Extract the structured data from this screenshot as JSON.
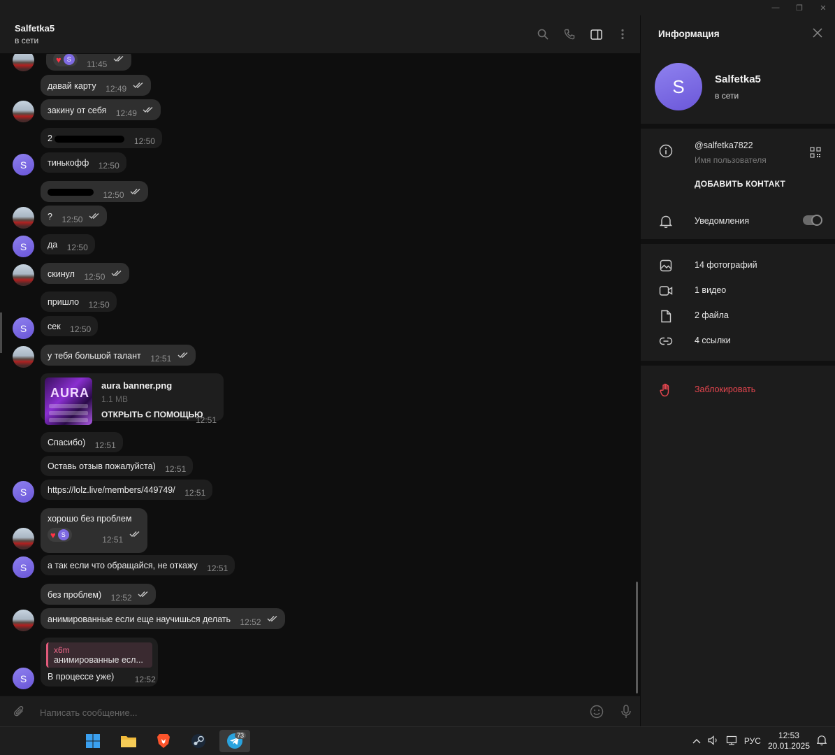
{
  "chat": {
    "peer_name": "Salfetka5",
    "peer_status": "в сети",
    "composer_placeholder": "Написать сообщение..."
  },
  "messages": [
    {
      "text": "",
      "time": "11:45",
      "reaction": "♥",
      "reaction_user": "S"
    },
    {
      "text": "давай карту",
      "time": "12:49"
    },
    {
      "text": "закину от себя",
      "time": "12:49"
    },
    {
      "text": "2",
      "time": "12:50",
      "redacted": true
    },
    {
      "text": "тинькофф",
      "time": "12:50"
    },
    {
      "text": "",
      "time": "12:50",
      "redacted": true
    },
    {
      "text": "?",
      "time": "12:50"
    },
    {
      "text": "да",
      "time": "12:50"
    },
    {
      "text": "скинул",
      "time": "12:50"
    },
    {
      "text": "пришло",
      "time": "12:50"
    },
    {
      "text": "сек",
      "time": "12:50"
    },
    {
      "text": "у тебя большой талант",
      "time": "12:51"
    },
    {
      "file_name": "aura banner.png",
      "file_size": "1.1 MB",
      "open_with": "ОТКРЫТЬ С ПОМОЩЬЮ",
      "thumb_text": "AURA",
      "time": "12:51"
    },
    {
      "text": "Спасибо)",
      "time": "12:51"
    },
    {
      "text": "Оставь отзыв пожалуйста)",
      "time": "12:51"
    },
    {
      "text": "https://lolz.live/members/449749/",
      "time": "12:51"
    },
    {
      "text": "хорошо без проблем",
      "time": "12:51",
      "reaction": "♥",
      "reaction_user": "S"
    },
    {
      "text": "а так если что обращайся, не откажу",
      "time": "12:51"
    },
    {
      "text": "без проблем)",
      "time": "12:52"
    },
    {
      "text": "анимированные если еще научишься делать",
      "time": "12:52"
    },
    {
      "reply_name": "x6m",
      "reply_text": "анимированные есл...",
      "text": "В процессе уже)",
      "time": "12:52"
    }
  ],
  "avatar_letter": "S",
  "info": {
    "title": "Информация",
    "name": "Salfetka5",
    "status": "в сети",
    "avatar_letter": "S",
    "username": "@salfetka7822",
    "username_label": "Имя пользователя",
    "add_contact": "ДОБАВИТЬ КОНТАКТ",
    "notifications": "Уведомления",
    "notifications_on": true,
    "photos": "14 фотографий",
    "videos": "1 видео",
    "files": "2 файла",
    "links": "4 ссылки",
    "block": "Заблокировать"
  },
  "taskbar": {
    "telegram_badge": "73",
    "lang": "РУС",
    "time": "12:53",
    "date": "20.01.2025"
  },
  "colors": {
    "bubble": "#2f2f2f",
    "accent_avatar": "#7e6ae2",
    "danger": "#e8464f",
    "reply_accent": "#f0668a"
  }
}
